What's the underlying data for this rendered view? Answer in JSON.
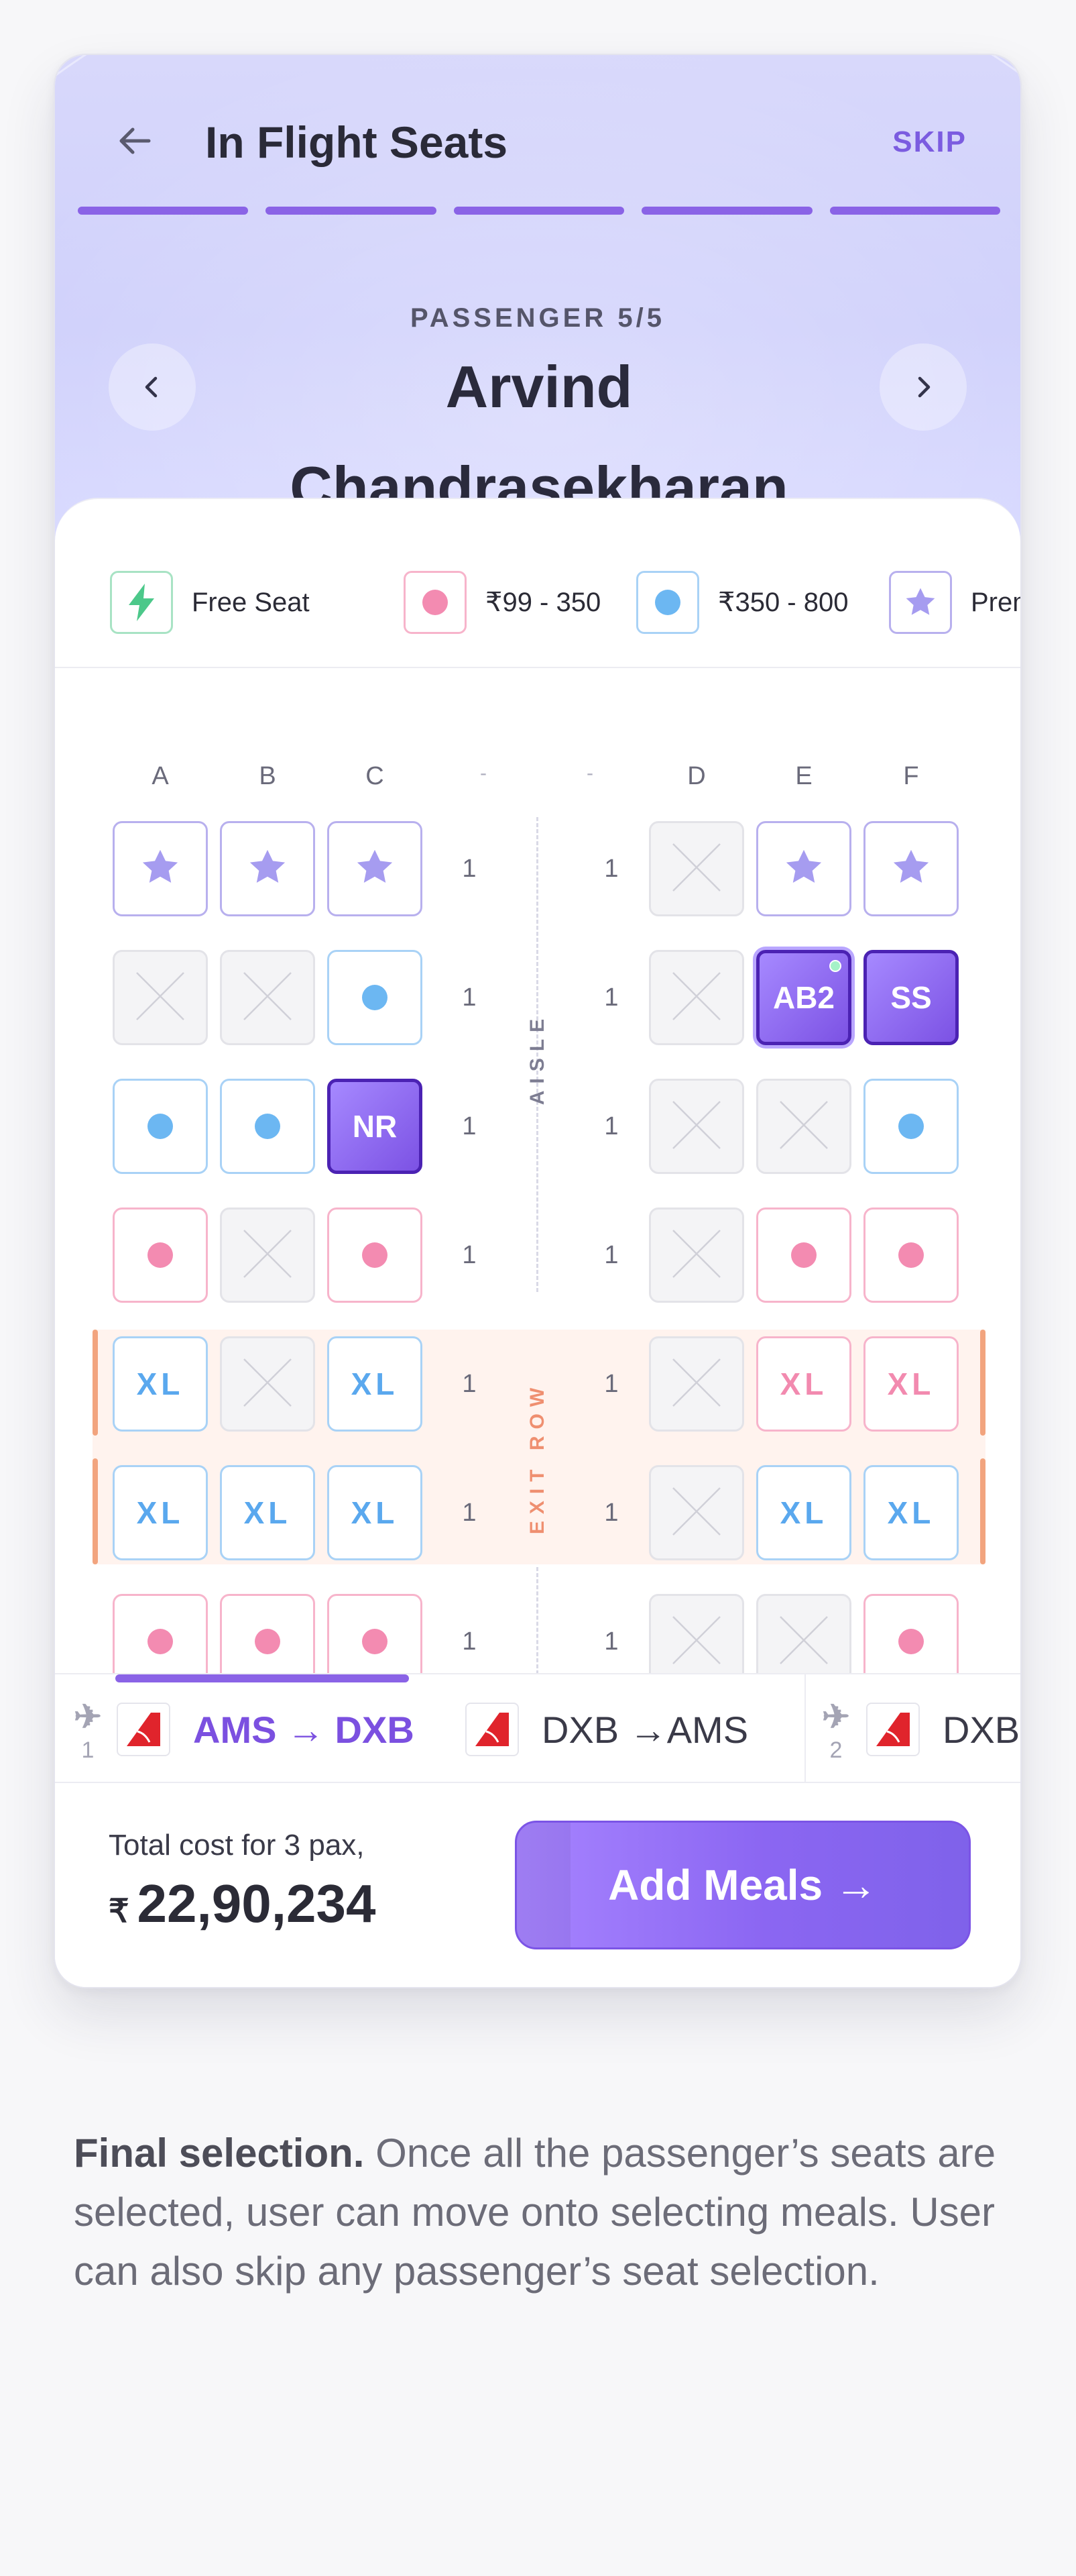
{
  "header": {
    "title": "In Flight Seats",
    "skip_label": "SKIP",
    "progress_steps_filled": 5,
    "progress_steps_total": 5
  },
  "passenger": {
    "label": "PASSENGER 5/5",
    "name": "Arvind Chandrasekharan"
  },
  "legend": [
    {
      "label": "Free Seat",
      "icon": "bolt-icon",
      "color": "#4cc88a"
    },
    {
      "label": "₹99 - 350",
      "icon": "pink-dot",
      "color": "#f38bb1"
    },
    {
      "label": "₹350 - 800",
      "icon": "blue-dot",
      "color": "#6cb7f2"
    },
    {
      "label": "Premium",
      "icon": "star-icon",
      "color": "#a69cf0"
    }
  ],
  "seatmap": {
    "columns_left": [
      "A",
      "B",
      "C"
    ],
    "columns_right": [
      "D",
      "E",
      "F"
    ],
    "aisle_marker": "-",
    "aisle_label": "AISLE",
    "exit_label": "EXIT ROW",
    "row_number": "1",
    "rows": [
      {
        "left": [
          {
            "t": "premium"
          },
          {
            "t": "premium"
          },
          {
            "t": "premium"
          }
        ],
        "right": [
          {
            "t": "blocked"
          },
          {
            "t": "premium"
          },
          {
            "t": "premium"
          }
        ]
      },
      {
        "left": [
          {
            "t": "blocked"
          },
          {
            "t": "blocked"
          },
          {
            "t": "blue"
          }
        ],
        "right": [
          {
            "t": "blocked"
          },
          {
            "t": "selected",
            "label": "AB2",
            "active": true
          },
          {
            "t": "selected",
            "label": "SS"
          }
        ]
      },
      {
        "left": [
          {
            "t": "blue"
          },
          {
            "t": "blue"
          },
          {
            "t": "selected",
            "label": "NR"
          }
        ],
        "right": [
          {
            "t": "blocked"
          },
          {
            "t": "blocked"
          },
          {
            "t": "blue"
          }
        ]
      },
      {
        "left": [
          {
            "t": "pink"
          },
          {
            "t": "blocked"
          },
          {
            "t": "pink"
          }
        ],
        "right": [
          {
            "t": "blocked"
          },
          {
            "t": "pink"
          },
          {
            "t": "pink"
          }
        ]
      },
      {
        "exit": true,
        "left": [
          {
            "t": "xl-blue",
            "label": "XL"
          },
          {
            "t": "blocked"
          },
          {
            "t": "xl-blue",
            "label": "XL"
          }
        ],
        "right": [
          {
            "t": "blocked"
          },
          {
            "t": "xl-pink",
            "label": "XL"
          },
          {
            "t": "xl-pink",
            "label": "XL"
          }
        ]
      },
      {
        "exit": true,
        "left": [
          {
            "t": "xl-blue",
            "label": "XL"
          },
          {
            "t": "xl-blue",
            "label": "XL"
          },
          {
            "t": "xl-blue",
            "label": "XL"
          }
        ],
        "right": [
          {
            "t": "blocked"
          },
          {
            "t": "xl-blue",
            "label": "XL"
          },
          {
            "t": "xl-blue",
            "label": "XL"
          }
        ]
      },
      {
        "left": [
          {
            "t": "pink"
          },
          {
            "t": "pink"
          },
          {
            "t": "pink"
          }
        ],
        "right": [
          {
            "t": "blocked"
          },
          {
            "t": "blocked"
          },
          {
            "t": "pink"
          }
        ]
      }
    ]
  },
  "legs": [
    {
      "number": "1",
      "route": "AMS → DXB",
      "active": true,
      "airline": "QANTAS"
    },
    {
      "number": "",
      "route": "DXB →AMS",
      "active": false,
      "airline": "QANTAS"
    },
    {
      "number": "2",
      "route": "DXB",
      "active": false,
      "airline": "QANTAS"
    }
  ],
  "footer": {
    "total_label": "Total cost for 3 pax,",
    "currency": "₹",
    "total_value": "22,90,234",
    "cta_label": "Add Meals →"
  },
  "caption": {
    "bold": "Final selection.",
    "text": " Once all the passenger’s seats are selected, user can move onto selecting meals. User can also skip any passenger’s seat selection."
  },
  "colors": {
    "accent": "#8a63e6",
    "selected_seat": "#7c52e4",
    "pink_price": "#f38bb1",
    "blue_price": "#6cb7f2",
    "premium": "#a69cf0",
    "exit_row": "#f2a47e"
  }
}
